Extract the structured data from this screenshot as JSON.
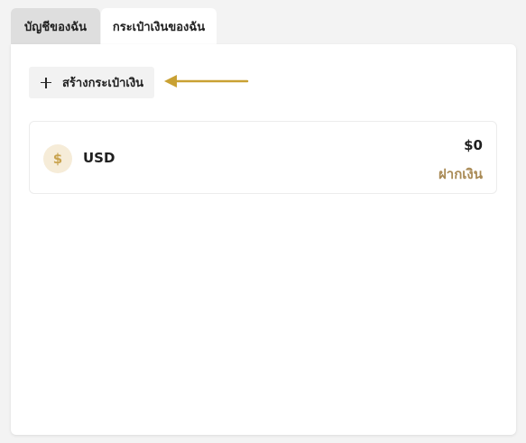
{
  "tabs": [
    {
      "label": "บัญชีของฉัน",
      "active": false
    },
    {
      "label": "กระเป๋าเงินของฉัน",
      "active": true
    }
  ],
  "toolbar": {
    "create_wallet_label": "สร้างกระเป๋าเงิน",
    "create_wallet_icon": "plus-icon"
  },
  "annotation": {
    "arrow_color": "#c9a133",
    "arrow_icon": "arrow-left-icon"
  },
  "wallets": [
    {
      "coin_symbol": "$",
      "currency": "USD",
      "balance": "$0",
      "action_label": "ฝากเงิน"
    }
  ],
  "colors": {
    "accent": "#a98a55",
    "coin_bg": "#f6ecd8",
    "coin_fg": "#c9a34e"
  }
}
